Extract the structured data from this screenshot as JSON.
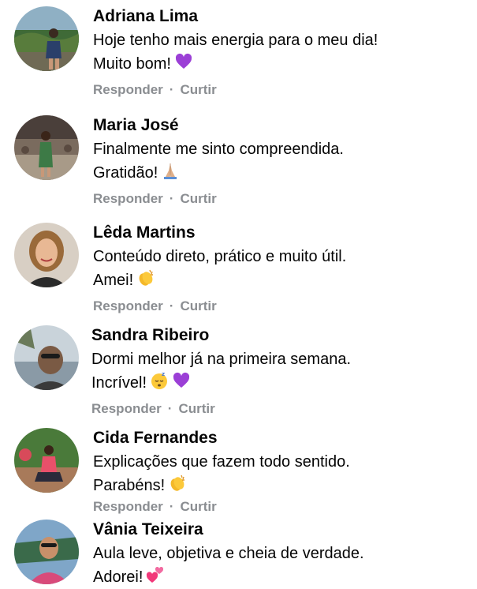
{
  "comments": [
    {
      "author": "Adriana Lima",
      "line1": "Hoje tenho mais energia para o meu dia!",
      "line2": "Muito bom!",
      "emojis": [
        "purple-heart"
      ],
      "reply": "Responder",
      "like": "Curtir",
      "separator": "·"
    },
    {
      "author": "Maria José",
      "line1": "Finalmente me sinto compreendida.",
      "line2": "Gratidão!",
      "emojis": [
        "folded-hands"
      ],
      "reply": "Responder",
      "like": "Curtir",
      "separator": "·"
    },
    {
      "author": "Lêda Martins",
      "line1": "Conteúdo direto, prático e muito útil.",
      "line2": "Amei!",
      "emojis": [
        "clapping-hands"
      ],
      "reply": "Responder",
      "like": "Curtir",
      "separator": "·"
    },
    {
      "author": "Sandra Ribeiro",
      "line1": "Dormi melhor já na primeira semana.",
      "line2": "Incrível!",
      "emojis": [
        "sleeping-face",
        "purple-heart"
      ],
      "reply": "Responder",
      "like": "Curtir",
      "separator": "·"
    },
    {
      "author": "Cida Fernandes",
      "line1": "Explicações que fazem todo sentido.",
      "line2": "Parabéns!",
      "emojis": [
        "clapping-hands"
      ],
      "reply": "Responder",
      "like": "Curtir",
      "separator": "·"
    },
    {
      "author": "Vânia Teixeira",
      "line1": "Aula leve, objetiva e cheia de verdade.",
      "line2": "Adorei!",
      "emojis": [
        "two-hearts"
      ],
      "reply": "",
      "like": "",
      "separator": ""
    }
  ],
  "colors": {
    "text": "#050505",
    "action": "#8a8d91",
    "purple_heart": "#9b3fd6",
    "pink_heart": "#f2387a"
  }
}
